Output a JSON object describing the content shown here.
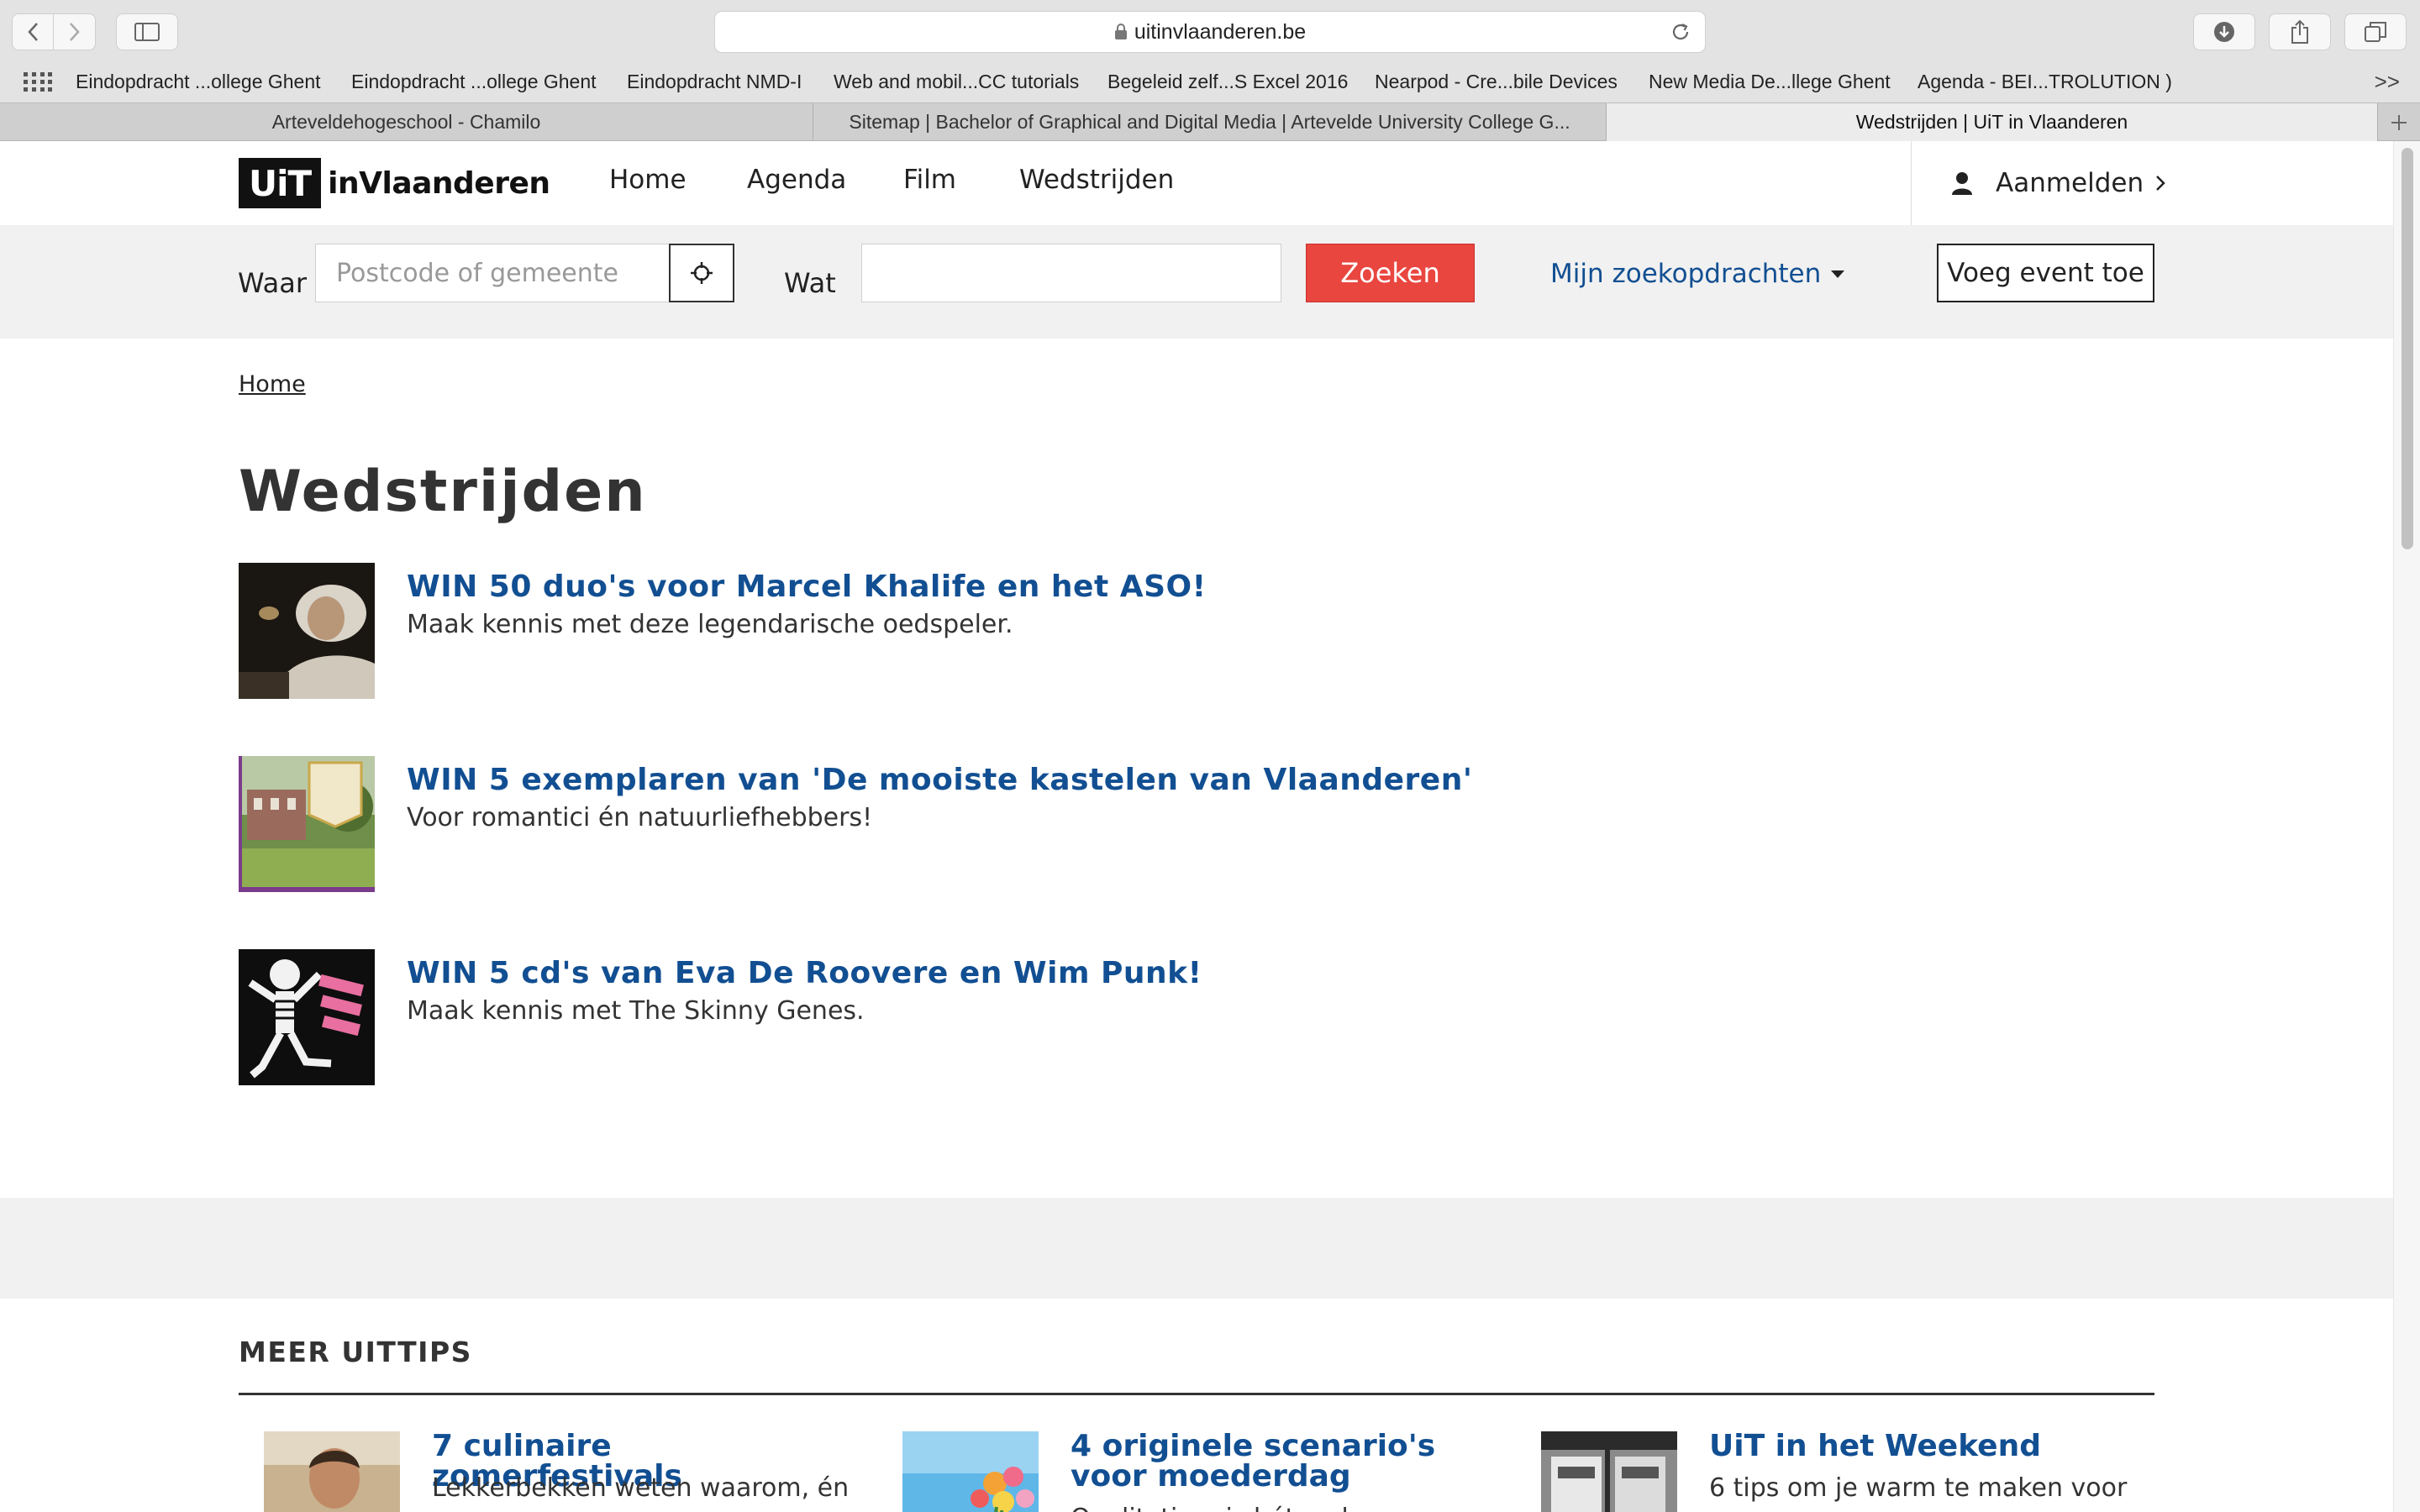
{
  "browser": {
    "url": "uitinvlaanderen.be",
    "bookmarks": [
      "Eindopdracht ...ollege Ghent",
      "Eindopdracht ...ollege Ghent",
      "Eindopdracht NMD-I",
      "Web and mobil...CC tutorials",
      "Begeleid zelf...S Excel 2016",
      "Nearpod - Cre...bile Devices",
      "New Media De...llege Ghent",
      "Agenda - BEI...TROLUTION )"
    ],
    "bookmarks_more": ">>",
    "tabs": [
      {
        "title": "Arteveldehogeschool - Chamilo",
        "active": false
      },
      {
        "title": "Sitemap | Bachelor of Graphical and Digital Media | Artevelde University College G...",
        "active": false
      },
      {
        "title": "Wedstrijden | UiT in Vlaanderen",
        "active": true
      }
    ]
  },
  "header": {
    "logo_box": "UiT",
    "logo_text": "inVlaanderen",
    "nav": [
      "Home",
      "Agenda",
      "Film",
      "Wedstrijden"
    ],
    "login_label": "Aanmelden"
  },
  "search": {
    "where_label": "Waar",
    "where_placeholder": "Postcode of gemeente",
    "what_label": "Wat",
    "what_value": "",
    "search_button": "Zoeken",
    "saved_searches": "Mijn zoekopdrachten",
    "add_event_button": "Voeg event toe"
  },
  "breadcrumb": "Home",
  "page_title": "Wedstrijden",
  "contests": [
    {
      "title": "WIN 50 duo's voor Marcel Khalife en het ASO!",
      "subtitle": "Maak kennis met deze legendarische oedspeler."
    },
    {
      "title": "WIN 5 exemplaren van 'De mooiste kastelen van Vlaanderen'",
      "subtitle": "Voor romantici én natuurliefhebbers!"
    },
    {
      "title": "WIN 5 cd's van Eva De Roovere en Wim Punk!",
      "subtitle": "Maak kennis met The Skinny Genes."
    }
  ],
  "more_tips": {
    "heading": "MEER UITTIPS",
    "items": [
      {
        "title": "7 culinaire zomerfestivals",
        "subtitle": "Lekkerbekken weten waarom, én"
      },
      {
        "title": "4 originele scenario's voor moederdag",
        "subtitle": "Qualitytime is hét cadeau"
      },
      {
        "title": "UiT in het Weekend",
        "subtitle": "6 tips om je warm te maken voor"
      }
    ]
  },
  "colors": {
    "link_blue": "#124f92",
    "search_red": "#e9463f",
    "band_grey": "#f1f1f1"
  }
}
